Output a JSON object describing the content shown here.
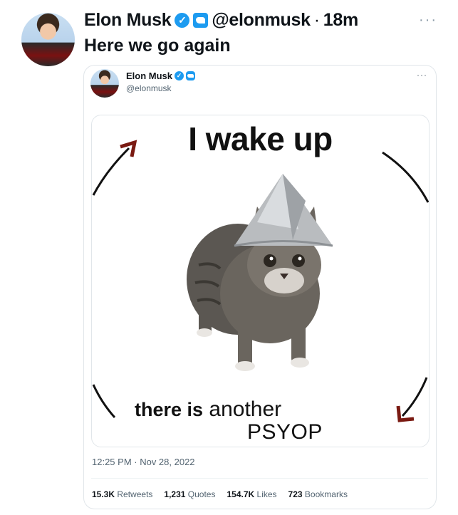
{
  "tweet": {
    "author_name": "Elon Musk",
    "handle": "@elonmusk",
    "separator": "·",
    "time_ago": "18m",
    "text": "Here we go again",
    "more_icon": "ellipsis-icon"
  },
  "quoted": {
    "author_name": "Elon Musk",
    "handle": "@elonmusk",
    "more_icon": "ellipsis-icon",
    "meme": {
      "top_text": "I wake up",
      "bottom_text_1": "there is",
      "bottom_text_2": "another",
      "bottom_text_3": "PSYOP"
    },
    "timestamp": "12:25 PM · Nov 28, 2022",
    "stats": [
      {
        "value": "15.3K",
        "label": "Retweets"
      },
      {
        "value": "1,231",
        "label": "Quotes"
      },
      {
        "value": "154.7K",
        "label": "Likes"
      },
      {
        "value": "723",
        "label": "Bookmarks"
      }
    ]
  },
  "colors": {
    "verified_blue": "#1d9bf0",
    "text_primary": "#0f1419",
    "text_secondary": "#536471",
    "border": "#e1e6ea",
    "arrow_red": "#7a1a12"
  }
}
